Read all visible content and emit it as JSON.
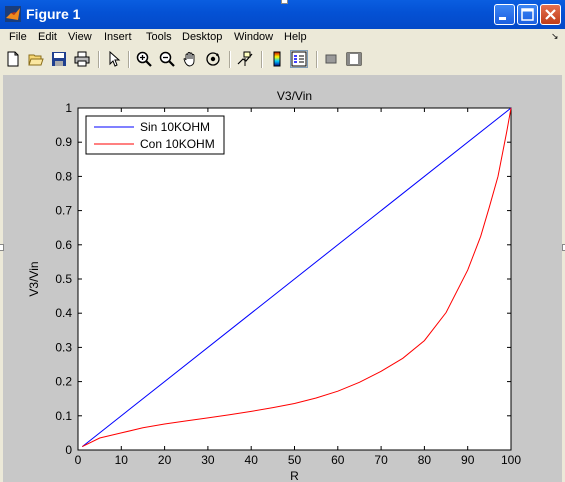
{
  "window": {
    "title": "Figure 1"
  },
  "menu": {
    "items": [
      "File",
      "Edit",
      "View",
      "Insert",
      "Tools",
      "Desktop",
      "Window",
      "Help"
    ],
    "overflow_arrow": "↘"
  },
  "toolbar": {
    "icons": [
      "new-figure-icon",
      "open-file-icon",
      "save-icon",
      "print-icon",
      "edit-plot-arrow-icon",
      "zoom-in-icon",
      "zoom-out-icon",
      "pan-hand-icon",
      "rotate-3d-icon",
      "data-cursor-icon",
      "colorbar-icon",
      "legend-icon",
      "hide-plot-tools-icon",
      "show-plot-tools-icon"
    ]
  },
  "colors": {
    "titlebar": "#0451d4",
    "figure_bg": "#c8c8c8",
    "series_sin": "#0000ff",
    "series_con": "#ff0000"
  },
  "chart_data": {
    "type": "line",
    "title": "V3/Vin",
    "xlabel": "R",
    "ylabel": "V3/Vin",
    "xlim": [
      0,
      100
    ],
    "ylim": [
      0,
      1
    ],
    "xticks": [
      "0",
      "10",
      "20",
      "30",
      "40",
      "50",
      "60",
      "70",
      "80",
      "90",
      "100"
    ],
    "yticks": [
      "0",
      "0.1",
      "0.2",
      "0.3",
      "0.4",
      "0.5",
      "0.6",
      "0.7",
      "0.8",
      "0.9",
      "1"
    ],
    "grid": false,
    "legend_position": "top-left",
    "series": [
      {
        "name": "Sin 10KOHM",
        "color": "#0000ff",
        "x": [
          1,
          100
        ],
        "y": [
          0.01,
          1.0
        ]
      },
      {
        "name": "Con 10KOHM",
        "color": "#ff0000",
        "x": [
          1,
          5,
          10,
          15,
          20,
          25,
          30,
          35,
          40,
          45,
          50,
          55,
          60,
          65,
          70,
          75,
          80,
          85,
          90,
          93,
          95,
          97,
          99,
          100
        ],
        "y": [
          0.01,
          0.035,
          0.05,
          0.065,
          0.076,
          0.085,
          0.094,
          0.103,
          0.113,
          0.124,
          0.136,
          0.152,
          0.172,
          0.198,
          0.23,
          0.268,
          0.32,
          0.402,
          0.526,
          0.625,
          0.71,
          0.8,
          0.93,
          1.0
        ]
      }
    ]
  }
}
